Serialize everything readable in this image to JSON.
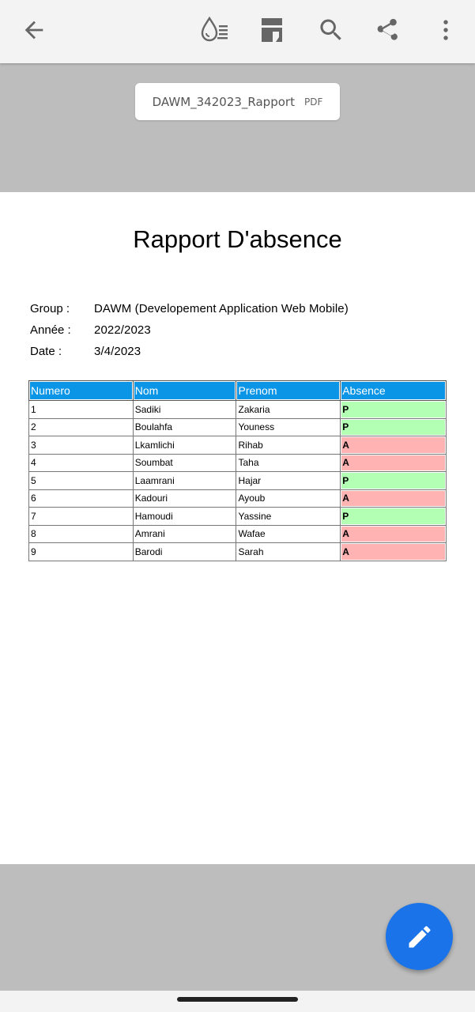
{
  "toolbar": {
    "icons": [
      "back-arrow-icon",
      "liquid-mode-icon",
      "document-icon",
      "search-icon",
      "share-icon",
      "more-vert-icon"
    ]
  },
  "file": {
    "name": "DAWM_342023_Rapport",
    "type": "PDF"
  },
  "document": {
    "title": "Rapport D'absence",
    "meta": [
      {
        "label": "Group :",
        "value": "DAWM (Developement Application  Web Mobile)"
      },
      {
        "label": "Année :",
        "value": "2022/2023"
      },
      {
        "label": "Date :",
        "value": "3/4/2023"
      }
    ],
    "table": {
      "headers": [
        "Numero",
        "Nom",
        "Prenom",
        "Absence"
      ],
      "rows": [
        [
          "1",
          "Sadiki",
          "Zakaria",
          "P"
        ],
        [
          "2",
          "Boulahfa",
          "Youness",
          "P"
        ],
        [
          "3",
          "Lkamlichi",
          "Rihab",
          "A"
        ],
        [
          "4",
          "Soumbat",
          "Taha",
          "A"
        ],
        [
          "5",
          "Laamrani",
          "Hajar",
          "P"
        ],
        [
          "6",
          "Kadouri",
          "Ayoub",
          "A"
        ],
        [
          "7",
          "Hamoudi",
          "Yassine",
          "P"
        ],
        [
          "8",
          "Amrani",
          "Wafae",
          "A"
        ],
        [
          "9",
          "Barodi",
          "Sarah",
          "A"
        ]
      ]
    }
  },
  "colors": {
    "header_blue": "#0b95e6",
    "present_green": "#b3ffb3",
    "absent_red": "#ffb3b3",
    "fab_blue": "#1a73e8"
  },
  "fab": {
    "icon": "pencil-icon"
  }
}
